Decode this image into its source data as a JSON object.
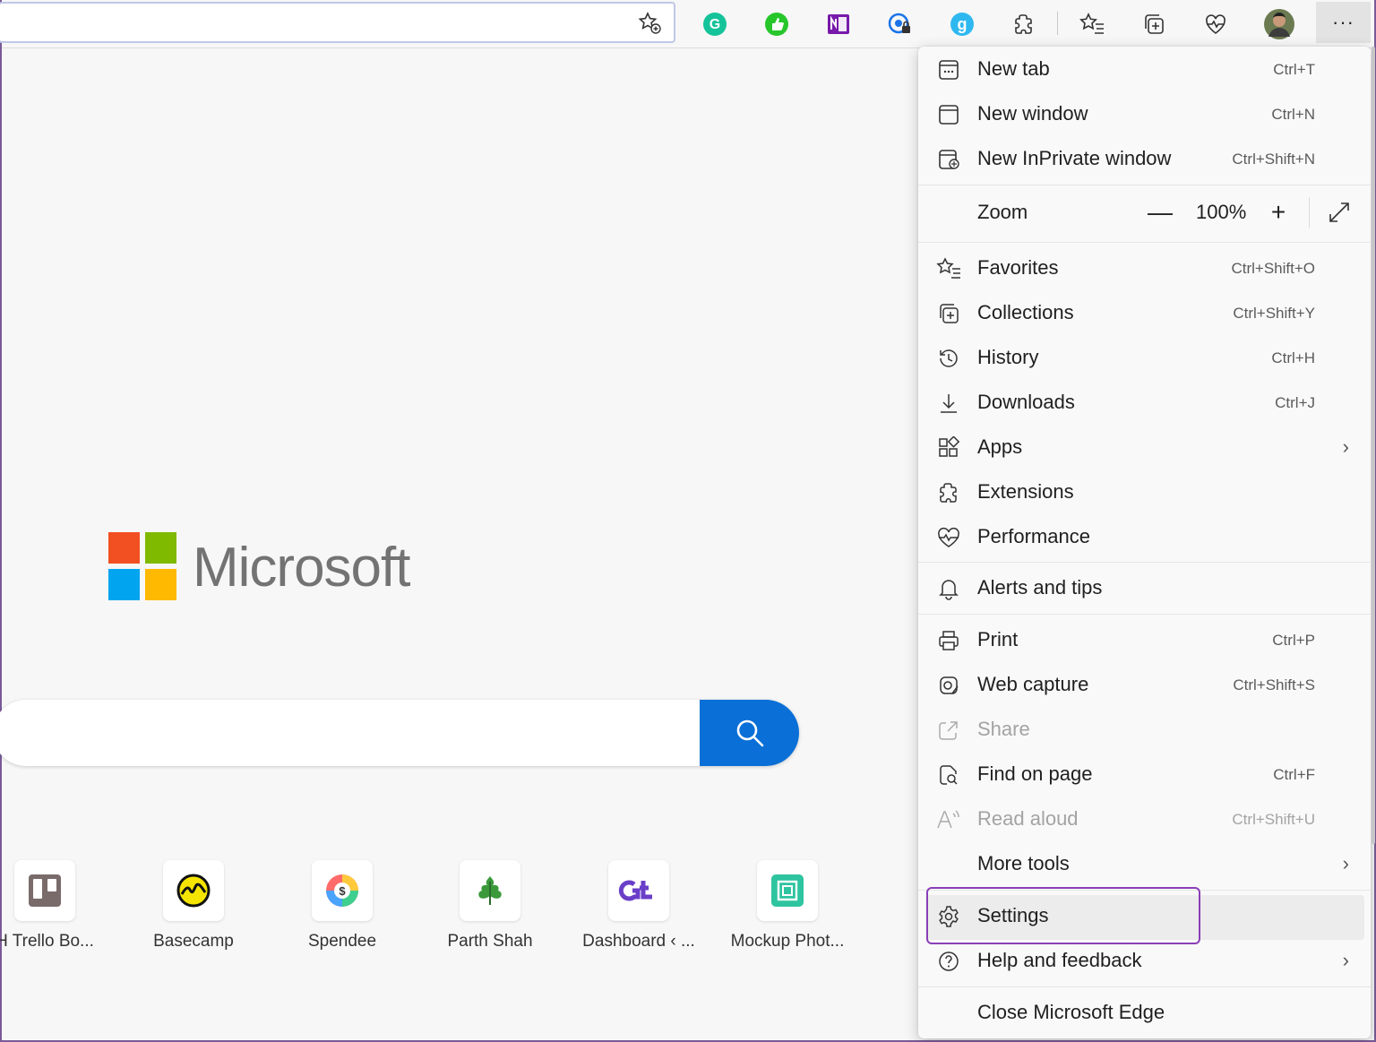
{
  "menu": {
    "new_tab": {
      "label": "New tab",
      "shortcut": "Ctrl+T"
    },
    "new_window": {
      "label": "New window",
      "shortcut": "Ctrl+N"
    },
    "new_inprivate": {
      "label": "New InPrivate window",
      "shortcut": "Ctrl+Shift+N"
    },
    "zoom": {
      "label": "Zoom",
      "value": "100%",
      "minus": "—",
      "plus": "+"
    },
    "favorites": {
      "label": "Favorites",
      "shortcut": "Ctrl+Shift+O"
    },
    "collections": {
      "label": "Collections",
      "shortcut": "Ctrl+Shift+Y"
    },
    "history": {
      "label": "History",
      "shortcut": "Ctrl+H"
    },
    "downloads": {
      "label": "Downloads",
      "shortcut": "Ctrl+J"
    },
    "apps": {
      "label": "Apps"
    },
    "extensions": {
      "label": "Extensions"
    },
    "performance": {
      "label": "Performance"
    },
    "alerts": {
      "label": "Alerts and tips"
    },
    "print": {
      "label": "Print",
      "shortcut": "Ctrl+P"
    },
    "web_capture": {
      "label": "Web capture",
      "shortcut": "Ctrl+Shift+S"
    },
    "share": {
      "label": "Share"
    },
    "find": {
      "label": "Find on page",
      "shortcut": "Ctrl+F"
    },
    "read_aloud": {
      "label": "Read aloud",
      "shortcut": "Ctrl+Shift+U"
    },
    "more_tools": {
      "label": "More tools"
    },
    "settings": {
      "label": "Settings"
    },
    "help": {
      "label": "Help and feedback"
    },
    "close": {
      "label": "Close Microsoft Edge"
    }
  },
  "page": {
    "brand": "Microsoft",
    "tiles": [
      "H Trello Bo...",
      "Basecamp",
      "Spendee",
      "Parth Shah",
      "Dashboard ‹ ...",
      "Mockup Phot..."
    ]
  },
  "toolbar": {
    "more_label": "···",
    "grammarly_letter": "G",
    "g_ext_letter": "g"
  },
  "colors": {
    "accent_highlight": "#8b3fb8",
    "search_button": "#0a6fd6",
    "ms_red": "#f25022",
    "ms_green": "#7fba00",
    "ms_blue": "#00a4ef",
    "ms_yellow": "#ffb900"
  }
}
